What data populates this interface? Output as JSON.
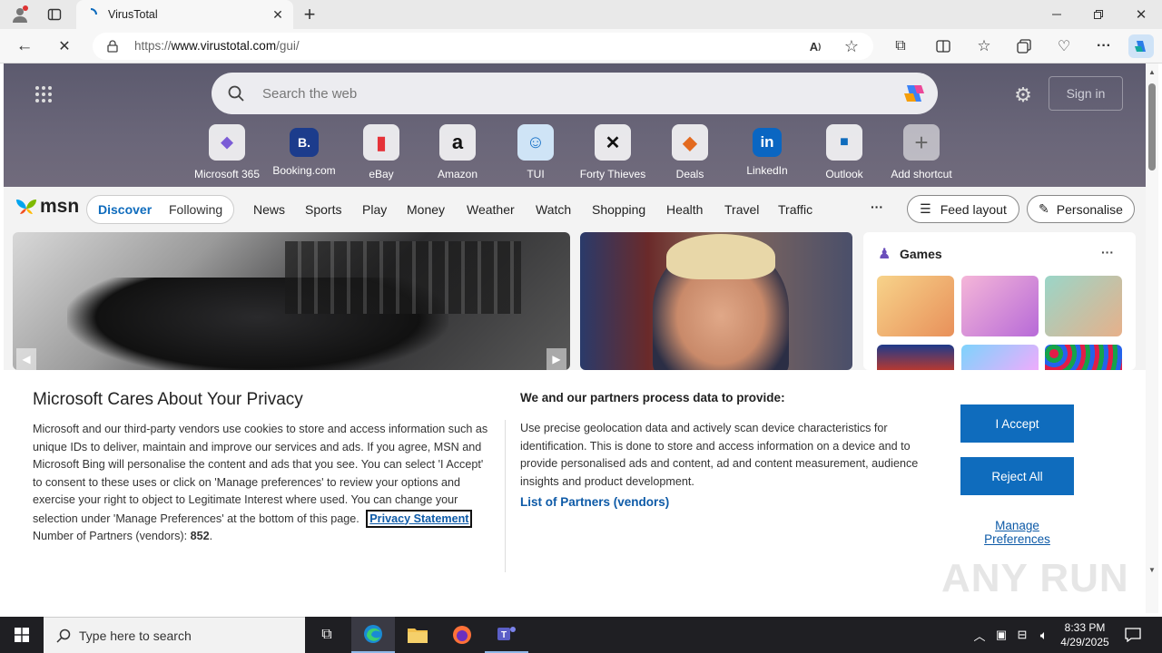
{
  "browser": {
    "tab_title": "VirusTotal",
    "url_prefix": "https://",
    "url_host": "www.virustotal.com",
    "url_path": "/gui/"
  },
  "newtab": {
    "search_placeholder": "Search the web",
    "sign_in": "Sign in",
    "shortcuts": [
      {
        "label": "Microsoft 365",
        "glyph": "◆"
      },
      {
        "label": "Booking.com",
        "glyph": "B."
      },
      {
        "label": "eBay",
        "glyph": "▮"
      },
      {
        "label": "Amazon",
        "glyph": "a"
      },
      {
        "label": "TUI",
        "glyph": "☺"
      },
      {
        "label": "Forty Thieves",
        "glyph": "✕"
      },
      {
        "label": "Deals",
        "glyph": "◆"
      },
      {
        "label": "LinkedIn",
        "glyph": "in"
      },
      {
        "label": "Outlook",
        "glyph": "■"
      },
      {
        "label": "Add shortcut",
        "glyph": "+"
      }
    ]
  },
  "msn": {
    "logo": "msn",
    "tabs": [
      "Discover",
      "Following"
    ],
    "nav": [
      "News",
      "Sports",
      "Play",
      "Money",
      "Weather",
      "Watch",
      "Shopping",
      "Health",
      "Travel",
      "Traffic"
    ],
    "more": "···",
    "feed_layout": "Feed layout",
    "personalise": "Personalise",
    "games_title": "Games",
    "games_more": "···"
  },
  "privacy": {
    "title": "Microsoft Cares About Your Privacy",
    "body": "Microsoft and our third-party vendors use cookies to store and access information such as unique IDs to deliver, maintain and improve our services and ads. If you agree, MSN and Microsoft Bing will personalise the content and ads that you see. You can select 'I Accept' to consent to these uses or click on 'Manage preferences' to review your options and exercise your right to object to Legitimate Interest where used.  You can change your selection under 'Manage Preferences' at the bottom of this page.",
    "privacy_link": "Privacy Statement",
    "partners_prefix": "Number of Partners (vendors): ",
    "partners_count": "852",
    "partners_suffix": ".",
    "right_title": "We and our partners process data to provide:",
    "right_body": "Use precise geolocation data and actively scan device characteristics for identification. This is done to store and access information on a device and to provide personalised ads and content, ad and content measurement, audience insights and product development.",
    "vendors_link": "List of Partners (vendors)",
    "accept": "I Accept",
    "reject": "Reject All",
    "manage": "Manage Preferences"
  },
  "taskbar": {
    "search_placeholder": "Type here to search",
    "time": "8:33 PM",
    "date": "4/29/2025"
  },
  "watermark": "ANY RUN",
  "colors": {
    "accent": "#0f6cbd",
    "link": "#0d5aa7",
    "taskbar": "#1f1f23"
  }
}
